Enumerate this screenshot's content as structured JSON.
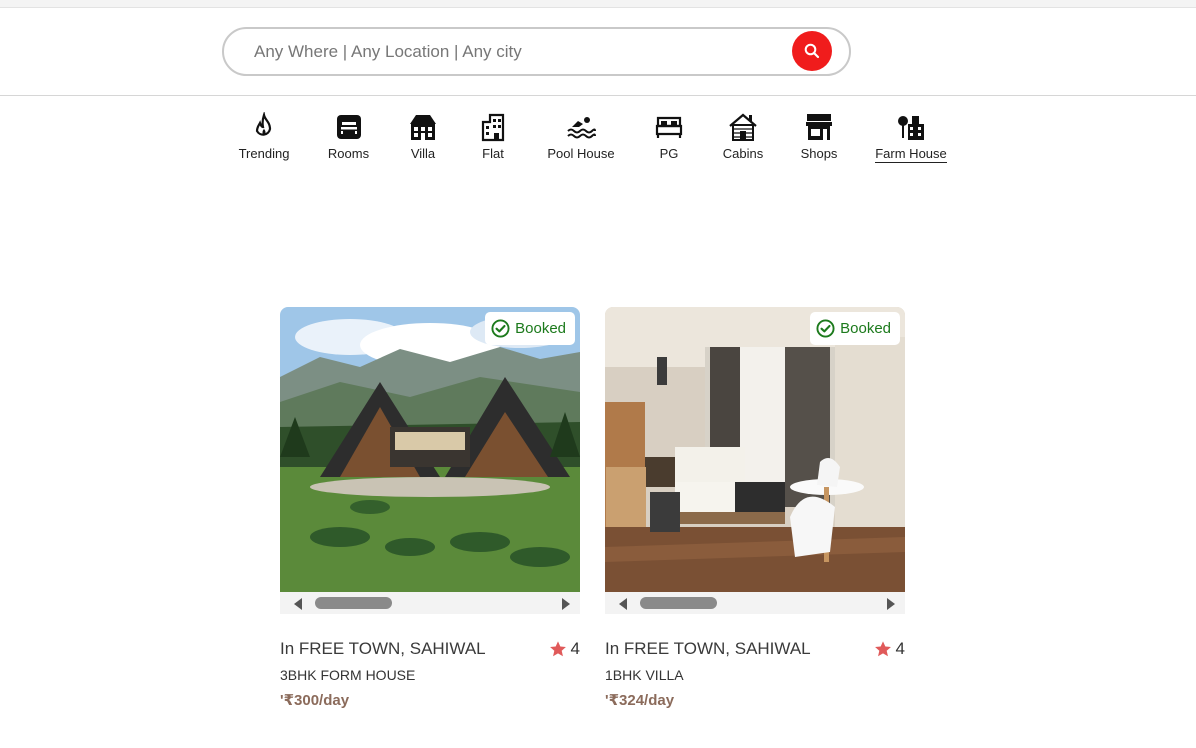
{
  "search": {
    "placeholder": "Any Where | Any Location | Any city"
  },
  "categories": [
    {
      "label": "Trending",
      "icon": "flame-icon"
    },
    {
      "label": "Rooms",
      "icon": "bed-box-icon"
    },
    {
      "label": "Villa",
      "icon": "villa-icon"
    },
    {
      "label": "Flat",
      "icon": "building-icon"
    },
    {
      "label": "Pool House",
      "icon": "swimmer-icon"
    },
    {
      "label": "PG",
      "icon": "bed-icon"
    },
    {
      "label": "Cabins",
      "icon": "cabin-icon"
    },
    {
      "label": "Shops",
      "icon": "shop-icon"
    },
    {
      "label": "Farm House",
      "icon": "farm-house-icon"
    }
  ],
  "listings": [
    {
      "badge": "Booked",
      "title": "In FREE TOWN, SAHIWAL",
      "rating": "4",
      "type": "3BHK FORM HOUSE",
      "price": "'₹300/day"
    },
    {
      "badge": "Booked",
      "title": "In FREE TOWN, SAHIWAL",
      "rating": "4",
      "type": "1BHK VILLA",
      "price": "'₹324/day"
    }
  ],
  "colors": {
    "accent": "#f01c1c",
    "booked": "#1c7a1c",
    "star": "#e05a5a",
    "price": "#8b6b5b"
  }
}
